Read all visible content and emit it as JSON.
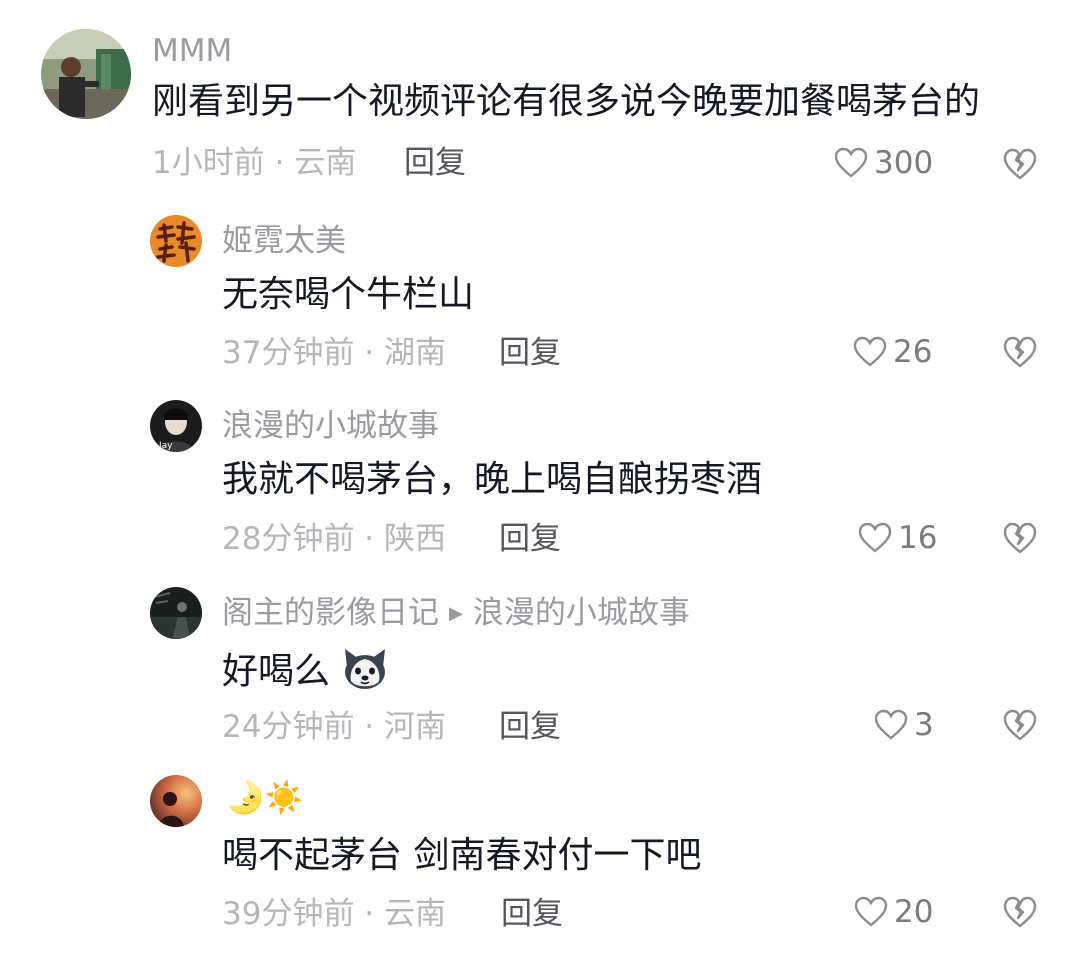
{
  "comments": [
    {
      "user": "MMM",
      "text": "刚看到另一个视频评论有很多说今晚要加餐喝茅台的",
      "meta": "1小时前 · 云南",
      "reply": "回复",
      "likes": "300",
      "avatar": "photo-man-standing"
    },
    {
      "user": "姬霓太美",
      "text": "无奈喝个牛栏山",
      "meta": "37分钟前 · 湖南",
      "reply": "回复",
      "likes": "26",
      "avatar": "orange-calligraphy"
    },
    {
      "user": "浪漫的小城故事",
      "text": "我就不喝茅台，晚上喝自酿拐枣酒",
      "meta": "28分钟前 · 陕西",
      "reply": "回复",
      "likes": "16",
      "avatar": "portrait-dark-jay"
    },
    {
      "user": "阁主的影像日记",
      "reply_to": "浪漫的小城故事",
      "text": "好喝么",
      "text_emoji": "husky-dog-emoji",
      "meta": "24分钟前 · 河南",
      "reply": "回复",
      "likes": "3",
      "avatar": "dark-night-photo"
    },
    {
      "user": "🌛☀️",
      "text": "喝不起茅台  剑南春对付一下吧",
      "meta": "39分钟前 · 云南",
      "reply": "回复",
      "likes": "20",
      "avatar": "sunset-silhouette"
    }
  ],
  "colors": {
    "username": "#9a9aa0",
    "content": "#161823",
    "meta": "#b5b5ba",
    "reply": "#55565c",
    "icon": "#8a8b90"
  }
}
